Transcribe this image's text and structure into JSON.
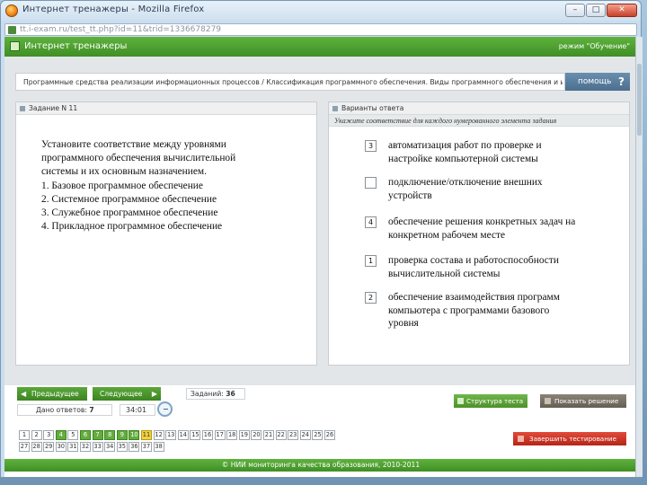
{
  "window": {
    "title": "Интернет тренажеры - Mozilla Firefox",
    "min": "–",
    "max": "□",
    "close": "✕",
    "url": "tt.i-exam.ru/test_tt.php?id=11&trid=1336678279"
  },
  "header": {
    "app_title": "Интернет тренажеры",
    "mode": "режим \"Обучение\""
  },
  "breadcrumb": "Программные средства реализации информационных процессов / Классификация программного обеспечения. Виды программного обеспечения и их",
  "help": {
    "label": "помощь",
    "icon": "?"
  },
  "task": {
    "header": "Задание N 11",
    "lines": [
      "Установите соответствие между уровнями",
      "программного обеспечения вычислительной",
      "системы и их основным назначением.",
      "1. Базовое программное обеспечение",
      "2. Системное программное обеспечение",
      "3. Служебное программное обеспечение",
      "4. Прикладное программное обеспечение"
    ]
  },
  "answers": {
    "header": "Варианты ответа",
    "instruction": "Укажите соответствие для каждого нумерованного элемента задания",
    "options": [
      {
        "value": "3",
        "line1": "автоматизация работ по проверке и",
        "line2": "настройке компьютерной системы",
        "line3": ""
      },
      {
        "value": "",
        "line1": "подключение/отключение внешних",
        "line2": "устройств",
        "line3": ""
      },
      {
        "value": "4",
        "line1": "обеспечение решения конкретных задач на",
        "line2": "конкретном рабочем месте",
        "line3": ""
      },
      {
        "value": "1",
        "line1": "проверка состава и работоспособности",
        "line2": "вычислительной системы",
        "line3": ""
      },
      {
        "value": "2",
        "line1": "обеспечение взаимодействия программ",
        "line2": "компьютера с программами базового",
        "line3": "уровня"
      }
    ]
  },
  "controls": {
    "prev": "Предыдущее",
    "next": "Следующее",
    "tasks_label": "Заданий:",
    "tasks_count": "36",
    "answered_label": "Дано ответов:",
    "answered_count": "7",
    "timer": "34:01",
    "structure": "Структура теста",
    "show_solution": "Показать решение",
    "finish": "Завершить тестирование"
  },
  "pager": {
    "pages": [
      "1",
      "2",
      "3",
      "4",
      "5",
      "6",
      "7",
      "8",
      "9",
      "10",
      "11",
      "12",
      "13",
      "14",
      "15",
      "16",
      "17",
      "18",
      "19",
      "20",
      "21",
      "22",
      "23",
      "24",
      "25",
      "26",
      "27",
      "28",
      "29",
      "30",
      "31",
      "32",
      "33",
      "34",
      "35",
      "36",
      "37",
      "38"
    ],
    "done": [
      "4",
      "6",
      "7",
      "8",
      "9",
      "10"
    ],
    "current": "11"
  },
  "footer": "© НИИ мониторинга качества образования, 2010-2011",
  "colors": {
    "brand_green": "#4fa02f",
    "done_green": "#62ad3d",
    "current_yellow": "#f3d23a",
    "finish_red": "#c83424"
  }
}
